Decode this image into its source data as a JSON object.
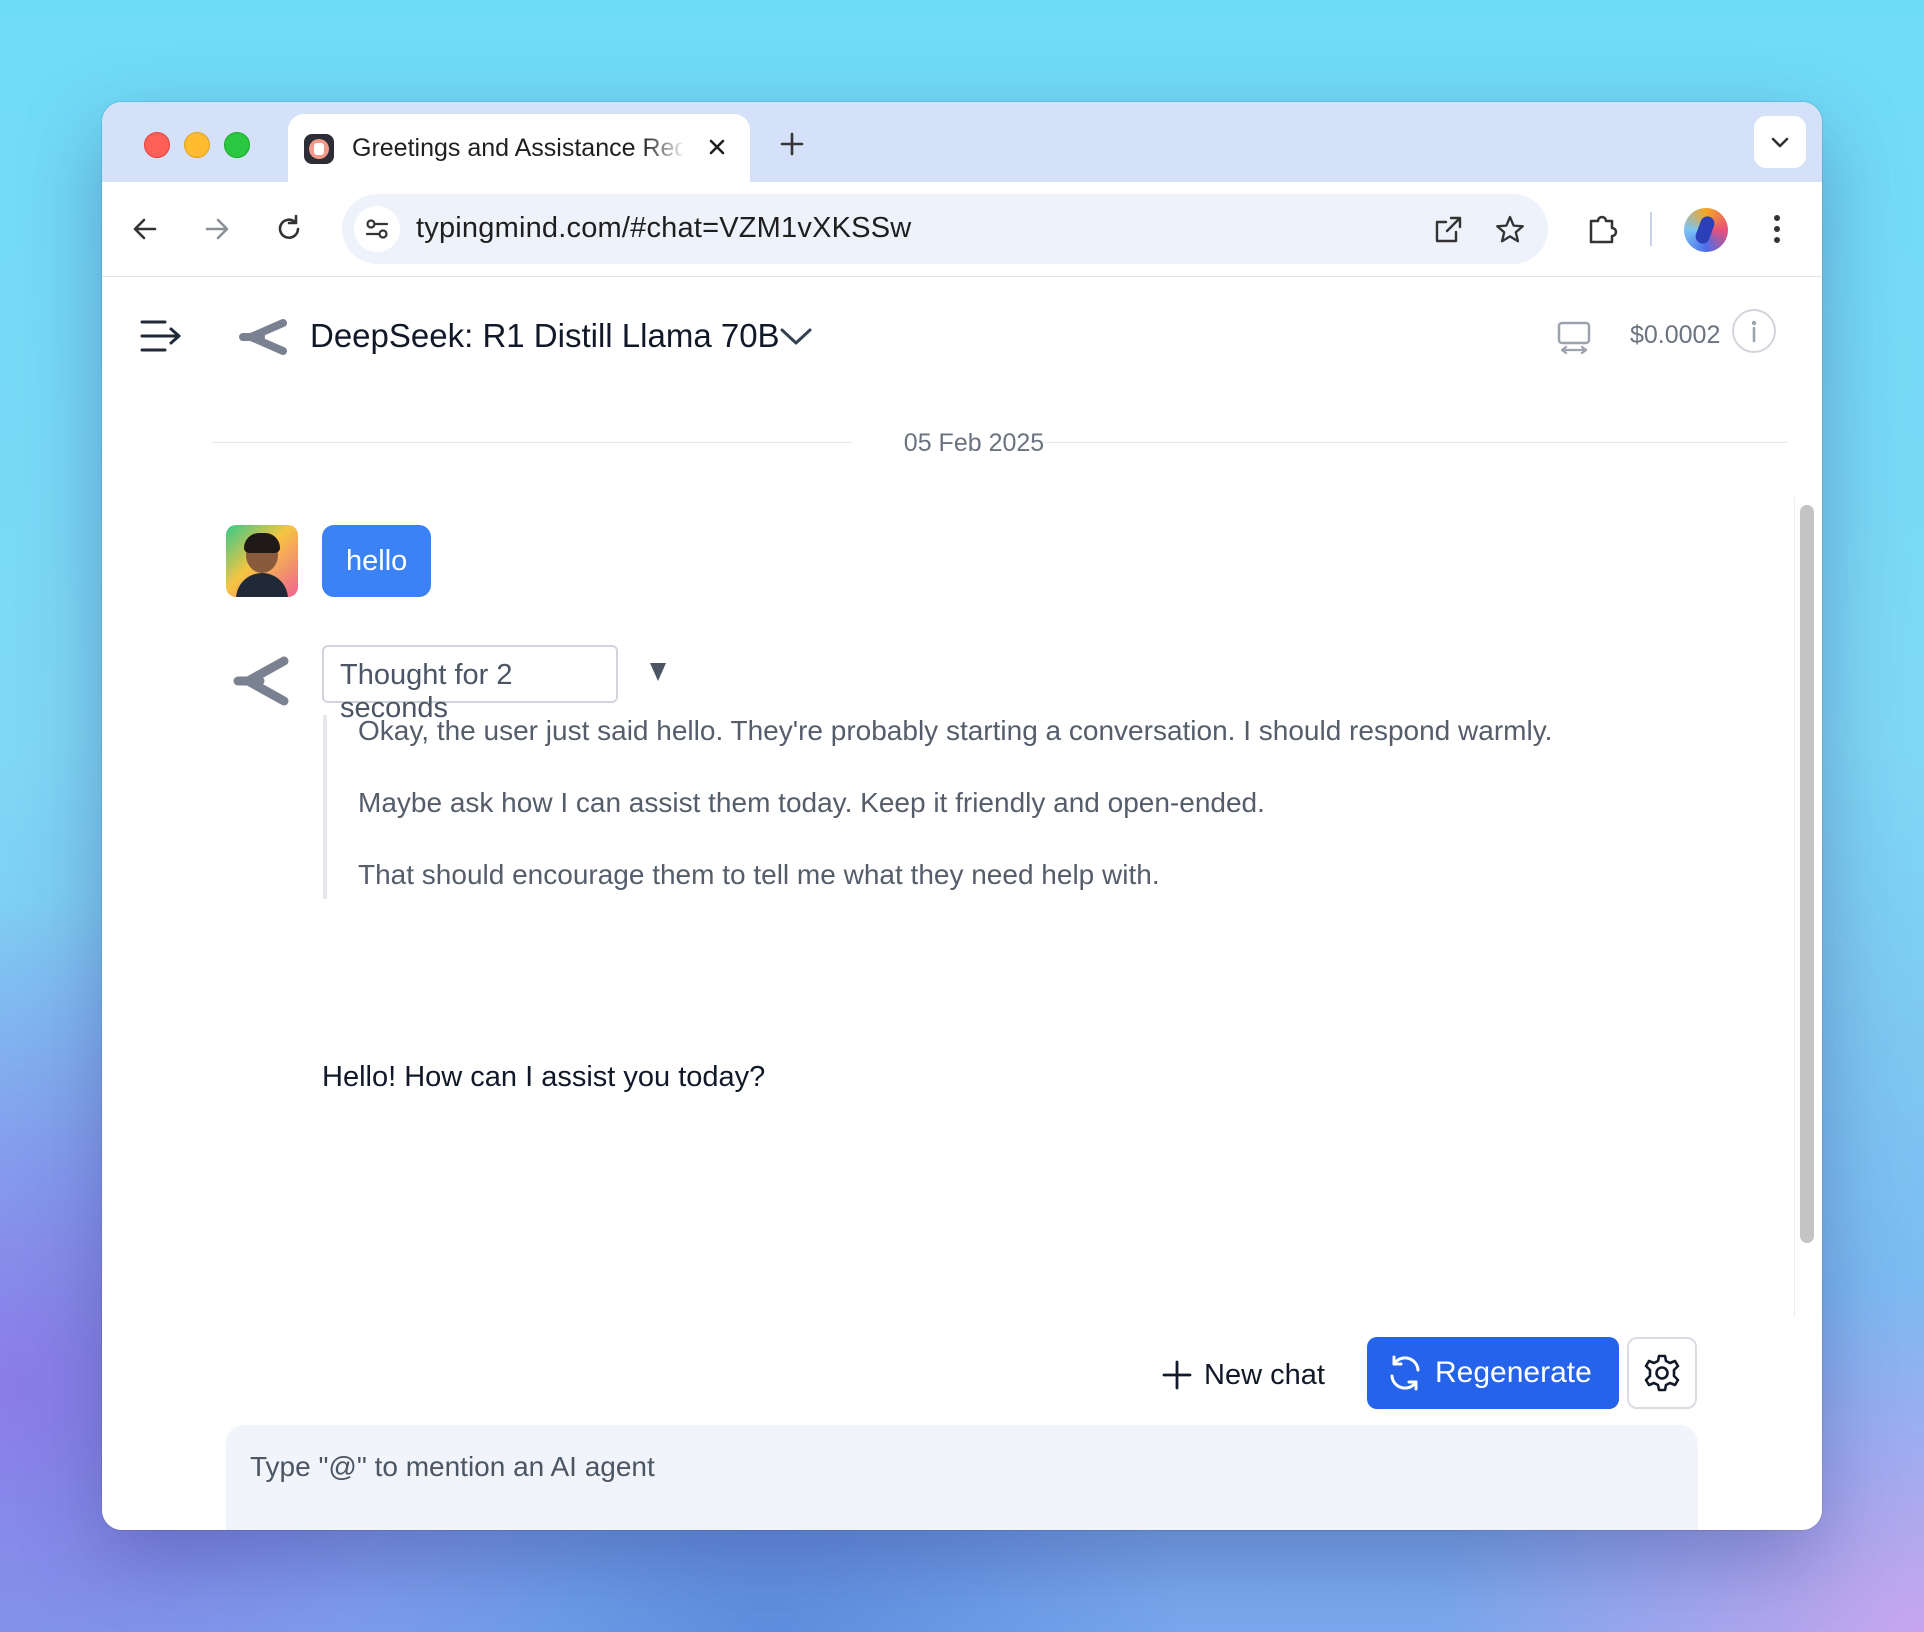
{
  "browser": {
    "tab": {
      "title": "Greetings and Assistance Request",
      "favicon": "typingmind-favicon"
    },
    "address_bar": {
      "url": "typingmind.com/#chat=VZM1vXKSSw"
    },
    "icons": [
      "back-arrow-icon",
      "forward-arrow-icon",
      "reload-icon",
      "site-info-icon",
      "open-external-icon",
      "star-icon",
      "extensions-icon",
      "profile-avatar",
      "more-menu-icon"
    ]
  },
  "header": {
    "model_name": "DeepSeek: R1 Distill Llama 70B",
    "cost": "$0.0002",
    "info_glyph": "i"
  },
  "chat": {
    "date": "05 Feb 2025",
    "user_message": "hello",
    "thought_toggle": "Thought for 2 seconds",
    "thought_lines": [
      "Okay, the user just said hello. They're probably starting a conversation. I should respond warmly.",
      "Maybe ask how I can assist them today. Keep it friendly and open-ended.",
      "That should encourage them to tell me what they need help with."
    ],
    "assistant_reply": "Hello! How can I assist you today?"
  },
  "actions": {
    "new_chat_label": "New chat",
    "regenerate_label": "Regenerate"
  },
  "composer": {
    "placeholder": "Type \"@\" to mention an AI agent",
    "value": "",
    "tools": [
      "search-icon",
      "mention-icon",
      "prompt-library-icon",
      "magic-wand-icon",
      "attachment-icon",
      "microphone-icon"
    ]
  },
  "colors": {
    "accent": "#2563eb",
    "user_bubble": "#3b82f6",
    "tab_strip": "#d4e1f8",
    "omnibox": "#eef2fb",
    "composer_bg": "#f1f5fb"
  }
}
